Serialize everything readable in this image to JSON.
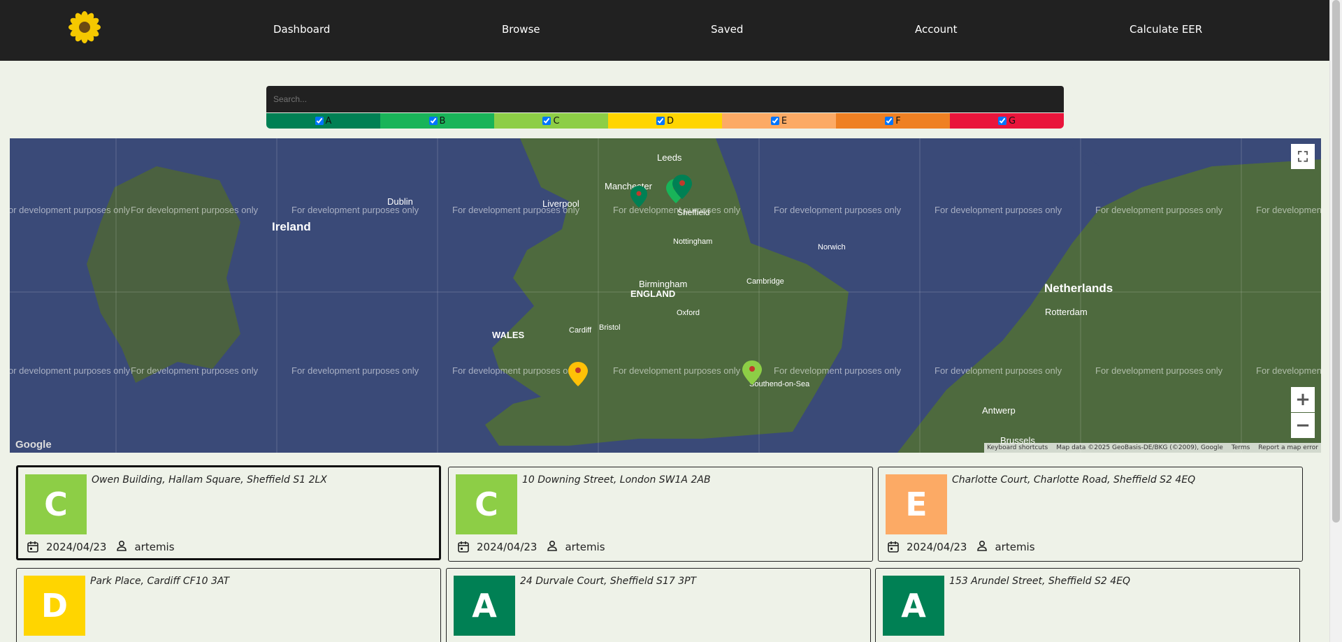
{
  "nav": {
    "items": [
      "Dashboard",
      "Browse",
      "Saved",
      "Account",
      "Calculate EER"
    ]
  },
  "search": {
    "placeholder": "Search..."
  },
  "filters": [
    {
      "label": "A",
      "color": "#008054",
      "checked": true
    },
    {
      "label": "B",
      "color": "#19b459",
      "checked": true
    },
    {
      "label": "C",
      "color": "#8dce46",
      "checked": true
    },
    {
      "label": "D",
      "color": "#ffd500",
      "checked": true
    },
    {
      "label": "E",
      "color": "#fcaa65",
      "checked": true
    },
    {
      "label": "F",
      "color": "#ef8023",
      "checked": true
    },
    {
      "label": "G",
      "color": "#e9153b",
      "checked": true
    }
  ],
  "map": {
    "watermark": "For development purposes only",
    "labels": [
      "Ireland",
      "Dublin",
      "Liverpool",
      "Manchester",
      "Leeds",
      "Sheffield",
      "Nottingham",
      "Birmingham",
      "WALES",
      "ENGLAND",
      "Cardiff",
      "Bristol",
      "Oxford",
      "Southend-on-Sea",
      "Netherlands",
      "Rotterdam",
      "Antwerp",
      "Brussels",
      "Norwich",
      "Cambridge"
    ],
    "attribution": [
      "Keyboard shortcuts",
      "Map data ©2025 GeoBasis-DE/BKG (©2009), Google",
      "Terms",
      "Report a map error"
    ],
    "logo": "Google",
    "zoom_in": "+",
    "zoom_out": "−"
  },
  "cards": [
    {
      "grade": "C",
      "color": "#8dce46",
      "address": "Owen Building, Hallam Square, Sheffield S1 2LX",
      "date": "2024/04/23",
      "user": "artemis",
      "selected": true
    },
    {
      "grade": "C",
      "color": "#8dce46",
      "address": "10 Downing Street, London SW1A 2AB",
      "date": "2024/04/23",
      "user": "artemis",
      "selected": false
    },
    {
      "grade": "E",
      "color": "#fcaa65",
      "address": "Charlotte Court, Charlotte Road, Sheffield S2 4EQ",
      "date": "2024/04/23",
      "user": "artemis",
      "selected": false
    },
    {
      "grade": "D",
      "color": "#ffd500",
      "address": "Park Place, Cardiff CF10 3AT",
      "date": "",
      "user": "",
      "selected": false
    },
    {
      "grade": "A",
      "color": "#008054",
      "address": "24 Durvale Court, Sheffield S17 3PT",
      "date": "",
      "user": "",
      "selected": false
    },
    {
      "grade": "A",
      "color": "#008054",
      "address": "153 Arundel Street, Sheffield S2 4EQ",
      "date": "",
      "user": "",
      "selected": false
    }
  ]
}
